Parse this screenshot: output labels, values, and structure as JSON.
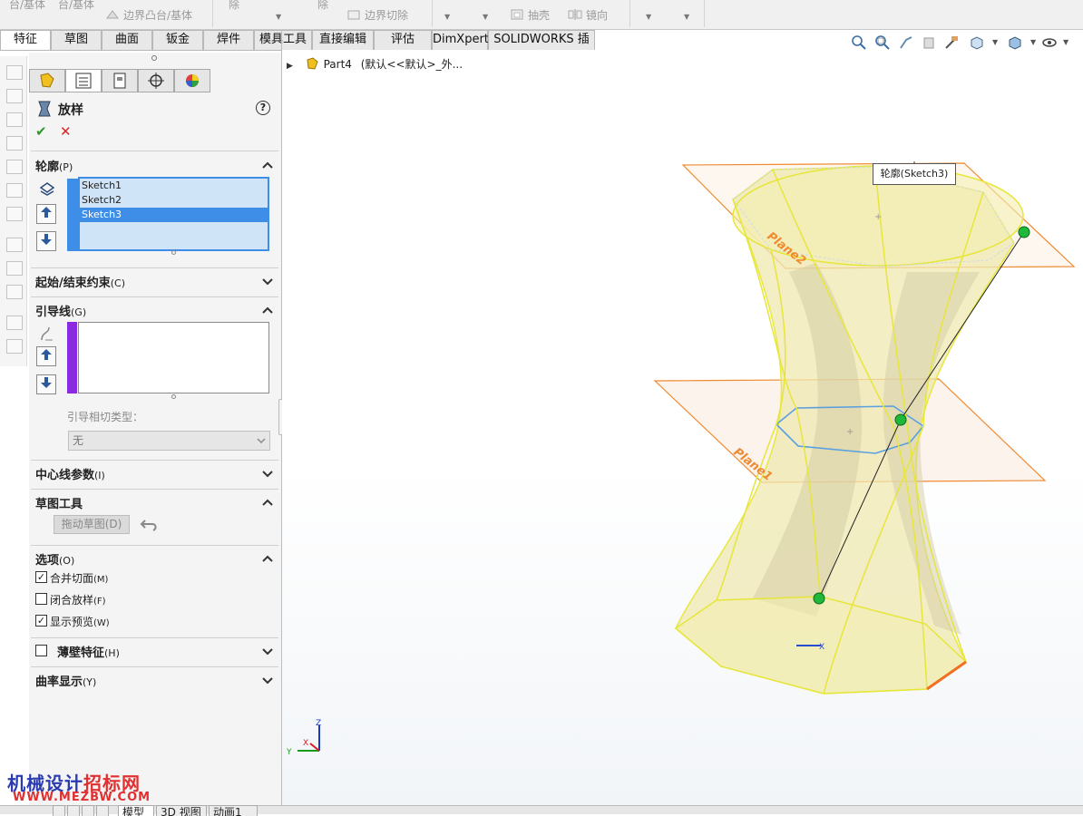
{
  "toolbar": {
    "items": [
      "台/基体",
      "台/基体",
      "边界凸台/基体",
      "除",
      "除",
      "边界切除",
      "抽壳",
      "镜向"
    ]
  },
  "tabs": [
    "特征",
    "草图",
    "曲面",
    "钣金",
    "焊件",
    "模具工具",
    "直接编辑",
    "评估",
    "DimXpert",
    "SOLIDWORKS 插件"
  ],
  "feature_manager": {
    "title": "放样",
    "help": "?",
    "ok": "✔",
    "cancel": "✕",
    "profiles": {
      "header": "轮廓",
      "key": "(P)",
      "items": [
        "Sketch1",
        "Sketch2",
        "Sketch3"
      ],
      "selected_index": 2
    },
    "start_end": {
      "header": "起始/结束约束",
      "key": "(C)"
    },
    "guides": {
      "header": "引导线",
      "key": "(G)",
      "tangent_label": "引导相切类型：",
      "tangent_value": "无"
    },
    "centerline": {
      "header": "中心线参数",
      "key": "(I)"
    },
    "sketch_tools": {
      "header": "草图工具",
      "drag_button": "拖动草图(D)"
    },
    "options": {
      "header": "选项",
      "key": "(O)",
      "checks": [
        {
          "label": "合并切面",
          "key": "(M)",
          "checked": true
        },
        {
          "label": "闭合放样",
          "key": "(F)",
          "checked": false
        },
        {
          "label": "显示预览",
          "key": "(W)",
          "checked": true
        }
      ]
    },
    "thin": {
      "header": "薄壁特征",
      "key": "(H)",
      "checked": false
    },
    "curvature": {
      "header": "曲率显示",
      "key": "(Y)"
    }
  },
  "tree": {
    "part": "Part4",
    "config": "(默认<<默认>_外..."
  },
  "viewport": {
    "tooltip": "轮廓(Sketch3)",
    "plane_labels": [
      "Plane1",
      "Plane2"
    ],
    "axis_labels": {
      "x": "X",
      "y": "Y",
      "z": "Z"
    }
  },
  "bottom_tabs": [
    "模型",
    "3D 视图",
    "动画1"
  ],
  "watermark": {
    "line1a": "机械设计",
    "line1b": "招标网",
    "line2": "WWW.MEZBW.COM"
  },
  "colors": {
    "accent_blue": "#3e8ee8",
    "plane_orange": "#f08a30",
    "surface_yellow": "#f2ef8a",
    "point_green": "#1fb83a",
    "guide_purple": "#8a2be2"
  }
}
